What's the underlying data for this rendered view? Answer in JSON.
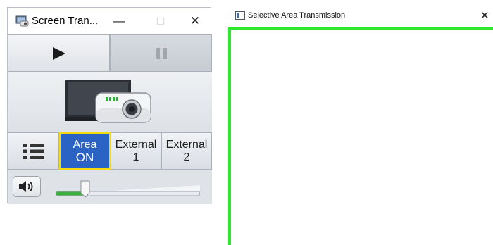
{
  "app_window": {
    "title": "Screen Tran...",
    "controls": {
      "minimize": "—",
      "maximize": "□",
      "close": "✕"
    },
    "transport": {
      "play_icon": "play-icon",
      "pause_icon": "pause-icon"
    },
    "display_icon": "projector-display-icon",
    "menu_icon": "list-menu-icon",
    "area_button": {
      "line1": "Area",
      "line2": "ON",
      "active": true
    },
    "external1": {
      "line1": "External",
      "line2": "1"
    },
    "external2": {
      "line1": "External",
      "line2": "2"
    },
    "volume": {
      "icon": "speaker-icon",
      "level": 0.2
    }
  },
  "selection_window": {
    "title": "Selective Area Transmission",
    "close": "✕",
    "frame_color": "#2ee82e"
  },
  "colors": {
    "active_button": "#2a63c4",
    "active_border": "#f5d90a",
    "volume_fill": "#3fae3f"
  }
}
